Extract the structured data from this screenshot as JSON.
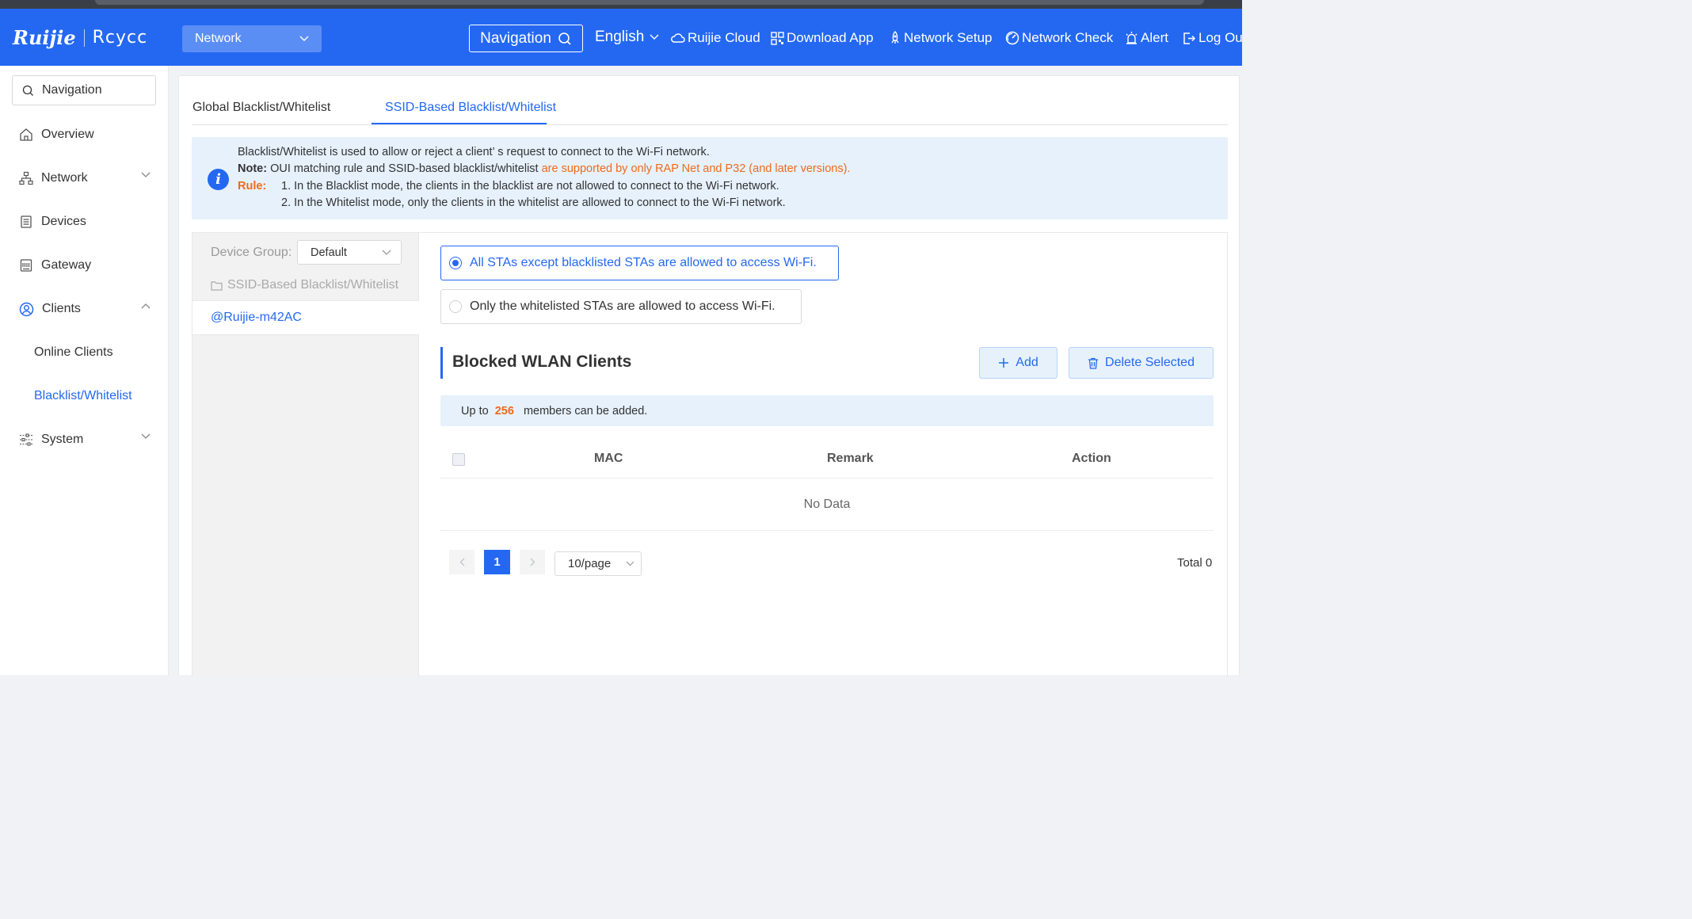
{
  "header": {
    "brand_primary": "Ruijie",
    "brand_secondary": "Rcycc",
    "project_select": "Network",
    "navigation_button": "Navigation",
    "language": "English",
    "items": {
      "cloud": "Ruijie Cloud",
      "download_app": "Download App",
      "network_setup": "Network Setup",
      "network_check": "Network Check",
      "alert": "Alert",
      "logout": "Log Ou"
    }
  },
  "sidebar": {
    "search_placeholder": "Navigation",
    "items": {
      "overview": "Overview",
      "network": "Network",
      "devices": "Devices",
      "gateway": "Gateway",
      "clients": "Clients",
      "online_clients": "Online Clients",
      "blacklist_whitelist": "Blacklist/Whitelist",
      "system": "System"
    }
  },
  "tabs": {
    "global": "Global Blacklist/Whitelist",
    "ssid": "SSID-Based Blacklist/Whitelist"
  },
  "info": {
    "line1": "Blacklist/Whitelist is used to allow or reject a client’ s request to connect to the Wi-Fi network.",
    "note_label": "Note:",
    "note_text": " OUI matching rule and SSID-based blacklist/whitelist ",
    "note_highlight": "are supported by only RAP Net and P32 (and later versions).",
    "rule_label": "Rule:",
    "rule1": "1. In the Blacklist mode, the clients in the blacklist are not allowed to connect to the Wi-Fi network.",
    "rule2": "2. In the Whitelist mode, only the clients in the whitelist are allowed to connect to the Wi-Fi network."
  },
  "left_pane": {
    "device_group_label": "Device Group:",
    "device_group_value": "Default",
    "folder_label": "SSID-Based Blacklist/Whitelist",
    "ssid": "@Ruijie-m42AC"
  },
  "mode": {
    "blacklist_option": "All STAs except blacklisted STAs are allowed to access Wi-Fi.",
    "whitelist_option": "Only the whitelisted STAs are allowed to access Wi-Fi.",
    "selected": "blacklist"
  },
  "section": {
    "title": "Blocked WLAN Clients",
    "add_button": "Add",
    "delete_button": "Delete Selected",
    "limit_prefix": "Up to ",
    "limit_value": "256",
    "limit_suffix": "  members can be added."
  },
  "table": {
    "columns": [
      "MAC",
      "Remark",
      "Action"
    ],
    "empty_text": "No Data"
  },
  "pagination": {
    "current_page": "1",
    "page_size": "10/page",
    "total": "Total 0"
  },
  "colors": {
    "primary": "#2468f2",
    "highlight": "#f06a1b",
    "info_bg": "#e6f1fc"
  }
}
